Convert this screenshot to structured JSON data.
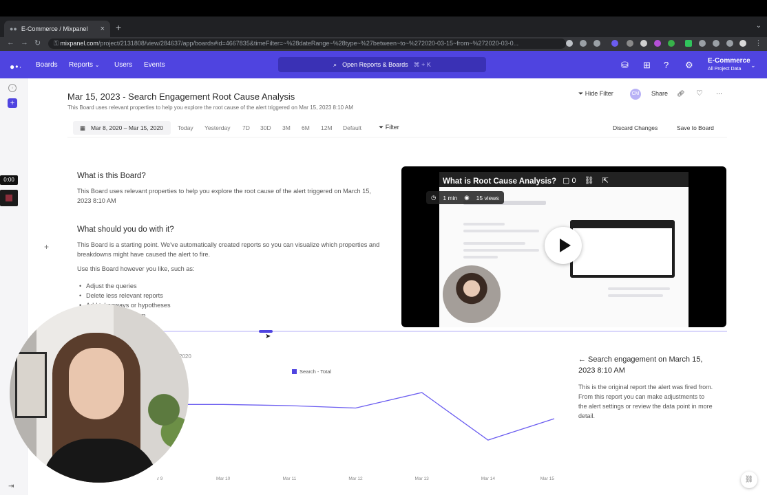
{
  "browser": {
    "tab_title": "E-Commerce / Mixpanel",
    "tab_close": "×",
    "new_tab": "+",
    "url_domain": "mixpanel.com",
    "url_path": "/project/2131808/view/284637/app/boards#id=4667835&timeFilter=~%28dateRange~%28type~%27between~to~%272020-03-15~from~%272020-03-0..."
  },
  "app_header": {
    "nav": [
      "Boards",
      "Reports",
      "Users",
      "Events"
    ],
    "search_label": "Open Reports & Boards",
    "search_shortcut": "⌘ + K",
    "project_name": "E-Commerce",
    "project_scope": "All Project Data"
  },
  "board": {
    "title": "Mar 15, 2023 - Search Engagement Root Cause Analysis",
    "description": "This Board uses relevant properties to help you explore the root cause of the alert triggered on Mar 15, 2023 8:10 AM",
    "hide_filter": "Hide Filter",
    "avatar_initials": "CM",
    "share": "Share",
    "date_range": "Mar 8, 2020 – Mar 15, 2020",
    "ranges": [
      "Today",
      "Yesterday",
      "7D",
      "30D",
      "3M",
      "6M",
      "12M",
      "Default"
    ],
    "filter": "Filter",
    "discard": "Discard Changes",
    "save": "Save to Board"
  },
  "text_card": {
    "h1": "What is this Board?",
    "p1": "This Board uses relevant properties to help you explore the root cause of the alert triggered on March 15, 2023 8:10 AM",
    "h2": "What should you do with it?",
    "p2": "This Board is a starting point. We've automatically created reports so you can visualize which properties and breakdowns might have caused the alert to fire.",
    "p3": "Use this Board however you like, such as:",
    "bullets": [
      "Adjust the queries",
      "Delete less relevant reports",
      "Add takeaways or hypotheses",
      "team"
    ]
  },
  "video": {
    "title": "What is Root Cause Analysis?",
    "comments": "0",
    "duration": "1 min",
    "views": "15 views"
  },
  "report": {
    "date_fragment": "2020",
    "side_title": "← Search engagement on March 15, 2023 8:10 AM",
    "side_desc": "This is the original report the alert was fired from. From this report you can make adjustments to the alert settings or review the data point in more detail."
  },
  "recording": {
    "timer": "0:00"
  },
  "chart_data": {
    "type": "line",
    "categories": [
      "Mar 9",
      "Mar 10",
      "Mar 11",
      "Mar 12",
      "Mar 13",
      "Mar 14",
      "Mar 15"
    ],
    "series": [
      {
        "name": "Search - Total",
        "values": [
          52,
          52,
          51,
          49,
          62,
          22,
          40
        ]
      }
    ],
    "ylim": [
      0,
      80
    ],
    "grid": false,
    "legend_position": "top-center",
    "color": "#6a5cf0"
  }
}
